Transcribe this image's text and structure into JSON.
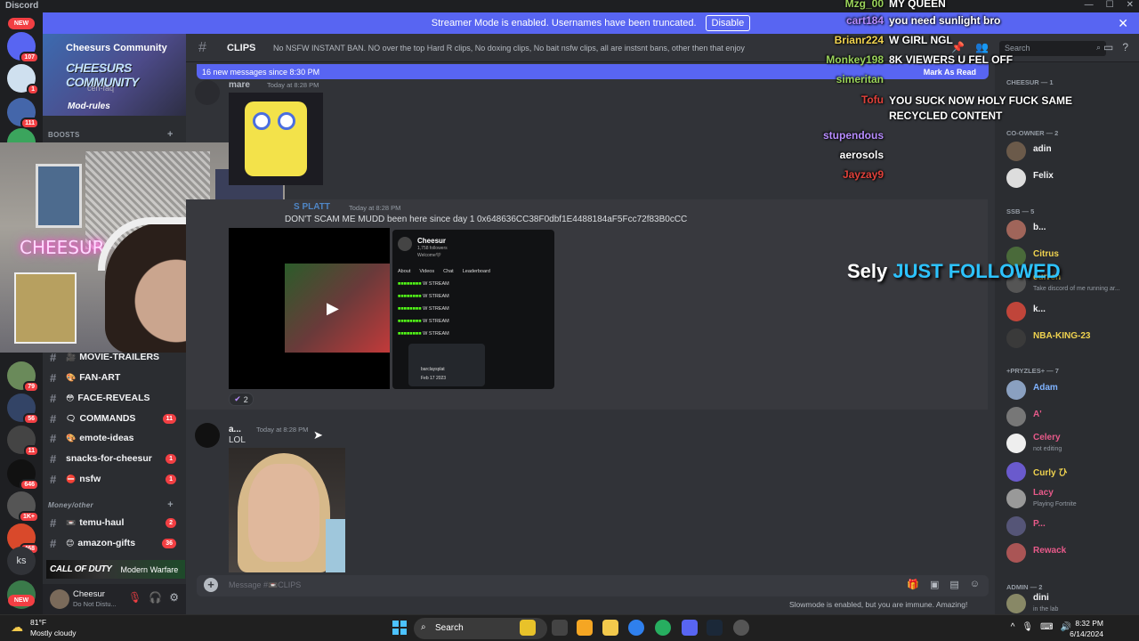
{
  "window": {
    "title": "Discord"
  },
  "banner": {
    "text": "Streamer Mode is enabled. Usernames have been truncated.",
    "disable_label": "Disable"
  },
  "server_rail": {
    "top_new": "NEW",
    "badges": [
      "107",
      "1",
      "111",
      "79",
      "56",
      "11",
      "646",
      "1K+",
      "468"
    ],
    "ks_label": "ks",
    "bottom_new": "NEW"
  },
  "server": {
    "name": "Cheesurs Community",
    "art_text": "CHEESURS COMMUNITY",
    "faq": "cen-faq",
    "rules": "Mod-rules"
  },
  "categories": {
    "boosts": "BOOSTS",
    "money": "Money/other"
  },
  "channels": [
    {
      "label": "MOVIE-TRAILERS",
      "emoji": "🎥",
      "count": ""
    },
    {
      "label": "FAN-ART",
      "emoji": "🎨",
      "count": ""
    },
    {
      "label": "FACE-REVEALS",
      "emoji": "😳",
      "count": ""
    },
    {
      "label": "COMMANDS",
      "emoji": "🗨",
      "count": "11"
    },
    {
      "label": "emote-ideas",
      "emoji": "🎨",
      "count": ""
    },
    {
      "label": "snacks-for-cheesur",
      "emoji": "",
      "count": "1"
    },
    {
      "label": "nsfw",
      "emoji": "⛔",
      "count": "1"
    },
    {
      "label": "temu-haul",
      "emoji": "📼",
      "count": "2"
    },
    {
      "label": "amazon-gifts",
      "emoji": "😊",
      "count": "36"
    }
  ],
  "cod_banner": {
    "logo": "CALL OF DUTY",
    "subtitle": "Modern Warfare"
  },
  "user_panel": {
    "name": "Cheesur",
    "status": "Do Not Distu..."
  },
  "webcam": {
    "neon": "CHEESUR"
  },
  "channel": {
    "name": "CLIPS",
    "topic": "No NSFW INSTANT BAN. NO over the top Hard R clips, No doxing clips, No bait nsfw clips, all are instsnt bans, other then that enjoy",
    "search_placeholder": "Search"
  },
  "new_messages": {
    "text": "16 new messages since 8:30 PM",
    "mark_read": "Mark As Read"
  },
  "messages": [
    {
      "author": "mare",
      "time": "Today at 8:28 PM",
      "text": "",
      "color": "#b5bac1"
    },
    {
      "author": "S PLATT",
      "time": "Today at 8:28 PM",
      "text": "DON'T SCAM ME MUDD been here since day 1",
      "extra": "0x648636CC38F0dbf1E4488184aF5Fcc72f83B0cCC",
      "reaction_count": "2",
      "color": "#4f86c6"
    },
    {
      "author": "a...",
      "time": "Today at 8:28 PM",
      "text": "LOL",
      "color": "#f2f3f5"
    }
  ],
  "embed": {
    "profile_name": "Cheesur",
    "followers": "1,758 followers",
    "welcome": "Welcome🖤",
    "tabs": [
      "About",
      "Videos",
      "Chat",
      "Leaderboard"
    ],
    "chat_text": "W STREAM",
    "chat_lines": 5,
    "popup_user": "barclaysplat",
    "popup_label": "Following Since",
    "popup_date": "Feb 17 2023"
  },
  "composer": {
    "placeholder": "Message #📼CLIPS"
  },
  "slowmode": "Slowmode is enabled, but you are immune. Amazing!",
  "members": {
    "groups": [
      {
        "label": "CHEESUR — 1"
      },
      {
        "label": "Co-Owner — 2"
      },
      {
        "label": "SSB — 5"
      },
      {
        "label": "+Pryzles+ — 7"
      },
      {
        "label": "Admin — 2"
      }
    ],
    "items": [
      {
        "name": "adin",
        "activity": "",
        "color": "#f2f3f5",
        "avatar": "#6b5a4a"
      },
      {
        "name": "Felix",
        "activity": "",
        "color": "#f2f3f5",
        "avatar": "#ddd"
      },
      {
        "name": "b...",
        "activity": "",
        "color": "#f2f3f5",
        "avatar": "#a0655a"
      },
      {
        "name": "Citrus",
        "activity": "",
        "color": "#f0d34f",
        "avatar": "#4a6a3a"
      },
      {
        "name": "curren",
        "activity": "Take discord of me running ar...",
        "color": "#f0d34f",
        "avatar": "#555"
      },
      {
        "name": "k...",
        "activity": "",
        "color": "#f2f3f5",
        "avatar": "#c0453a"
      },
      {
        "name": "NBA-KING-23",
        "activity": "",
        "color": "#f0d34f",
        "avatar": "#3a3a3a"
      },
      {
        "name": "Adam",
        "activity": "",
        "color": "#7fb3ff",
        "avatar": "#8aa0c0"
      },
      {
        "name": "A'",
        "activity": "",
        "color": "#e85a8a",
        "avatar": "#777"
      },
      {
        "name": "Celery",
        "activity": "not editing",
        "color": "#e85a8a",
        "avatar": "#eee"
      },
      {
        "name": "Curly ひ",
        "activity": "",
        "color": "#f0d34f",
        "avatar": "#6a5acd"
      },
      {
        "name": "Lacy",
        "activity": "Playing Fortnite",
        "color": "#e85a8a",
        "avatar": "#999"
      },
      {
        "name": "P...",
        "activity": "",
        "color": "#e85a8a",
        "avatar": "#557"
      },
      {
        "name": "Rewack",
        "activity": "",
        "color": "#e85a8a",
        "avatar": "#a55"
      },
      {
        "name": "dini",
        "activity": "in the lab",
        "color": "#f2f3f5",
        "avatar": "#886"
      }
    ]
  },
  "stream_chat": [
    {
      "user": "Mzg_00",
      "msg": "MY QUEEN",
      "color": "#9ad35a"
    },
    {
      "user": "cart184",
      "msg": "you need sunlight bro",
      "color": "#b78cff"
    },
    {
      "user": "Brianr224",
      "msg": "W GIRL NGL",
      "color": "#f0d34f"
    },
    {
      "user": "Monkey198",
      "msg": "8K VIEWERS U FEL OFF",
      "color": "#9ad35a"
    },
    {
      "user": "simeritan",
      "msg": "",
      "color": "#9ad35a"
    },
    {
      "user": "Tofu",
      "msg": "YOU SUCK NOW HOLY FUCK SAME RECYCLED CONTENT",
      "color": "#e0413a"
    },
    {
      "user": "stupendous",
      "msg": "",
      "color": "#b78cff"
    },
    {
      "user": "aerosols",
      "msg": "",
      "color": "#ffffff"
    },
    {
      "user": "Jayzay9",
      "msg": "",
      "color": "#e0413a"
    }
  ],
  "follow_alert": {
    "who": "Sely",
    "action": "JUST FOLLOWED"
  },
  "taskbar": {
    "temp": "81°F",
    "condition": "Mostly cloudy",
    "search": "Search",
    "time": "8:32 PM",
    "date": "6/14/2024"
  },
  "colors": {
    "accent": "#5865f2",
    "danger": "#f23f43",
    "bg": "#313338",
    "sidebar": "#2b2d31",
    "rail": "#1e1f22"
  }
}
